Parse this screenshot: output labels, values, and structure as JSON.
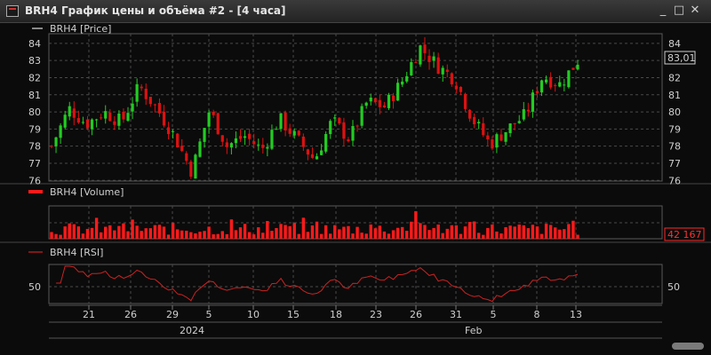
{
  "window": {
    "title": "BRH4 График цены и объёма #2 - [4 часа]",
    "controls": {
      "minimize": "_",
      "maximize": "□",
      "close": "✕"
    }
  },
  "price_panel": {
    "legend": "BRH4 [Price]",
    "y_ticks": [
      "84",
      "83",
      "82",
      "81",
      "80",
      "79",
      "78",
      "77",
      "76"
    ],
    "last_value": "83,01"
  },
  "volume_panel": {
    "legend": "BRH4 [Volume]",
    "last_value": "42 167"
  },
  "rsi_panel": {
    "legend": "BRH4 [RSI]",
    "y_tick": "50"
  },
  "time_axis": {
    "day_labels": [
      "21",
      "26",
      "29",
      "5",
      "10",
      "15",
      "18",
      "23",
      "26",
      "31",
      "5",
      "8",
      "13"
    ],
    "month_labels": [
      "2024",
      "Feb"
    ]
  },
  "colors": {
    "up": "#22cc22",
    "down": "#dd1111",
    "volume": "#ff1a1a",
    "rsi": "#cc2222",
    "grid": "#4a4a4a",
    "background": "#0b0b0b"
  },
  "chart_data": {
    "type": "candlestick",
    "bars_per_day": 6,
    "day_ticks": [
      21,
      26,
      29,
      5,
      10,
      15,
      18,
      23,
      26,
      31,
      5,
      8,
      13
    ],
    "price_range": [
      75.6,
      84.2
    ],
    "close_path": [
      78.0,
      80.2,
      79.3,
      80.0,
      79.4,
      81.5,
      80.2,
      78.6,
      76.5,
      80.1,
      78.0,
      78.6,
      77.8,
      79.6,
      78.4,
      77.2,
      79.5,
      78.4,
      80.6,
      80.3,
      81.8,
      83.8,
      82.7,
      81.9,
      79.6,
      78.1,
      79.0,
      79.8,
      82.1,
      81.6,
      83.0
    ],
    "volume_range": [
      0,
      100000
    ],
    "volume_last": 42167,
    "rsi_level": 50
  }
}
